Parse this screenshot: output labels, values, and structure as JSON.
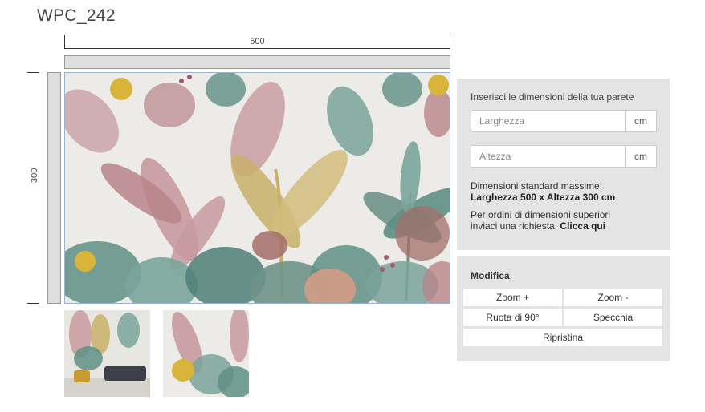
{
  "product": {
    "title": "WPC_242"
  },
  "rulers": {
    "width_label": "500",
    "height_label": "300"
  },
  "dimensions": {
    "instruction": "Inserisci le dimensioni della tua parete",
    "width_placeholder": "Larghezza",
    "height_placeholder": "Altezza",
    "unit": "cm",
    "standard_line1": "Dimensioni standard massime:",
    "standard_line2": "Larghezza 500 x Altezza 300 cm",
    "request_line1": "Per ordini di dimensioni superiori",
    "request_line2": "inviaci una richiesta.",
    "request_link": "Clicca qui"
  },
  "edit": {
    "title": "Modifica",
    "zoom_in": "Zoom +",
    "zoom_out": "Zoom -",
    "rotate": "Ruota di 90°",
    "mirror": "Specchia",
    "reset": "Ripristina"
  },
  "colors": {
    "panel_bg": "#e4e4e4",
    "mural_bg": "#ecebe7",
    "leaf_green": "#5f8f85",
    "leaf_pink": "#c89a9f",
    "leaf_ochre": "#c9b06a",
    "flower_yellow": "#d9b43a"
  }
}
